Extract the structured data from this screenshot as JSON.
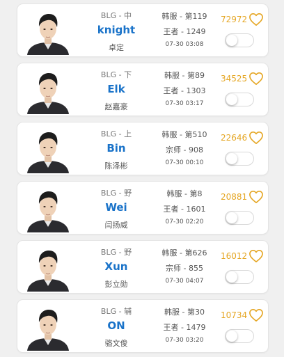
{
  "players": [
    {
      "team": "BLG - 中",
      "nickname": "knight",
      "name": "卓定",
      "server": "韩服 - 第119",
      "tier": "王者 - 1249",
      "time": "07-30 03:08",
      "likes": "72972"
    },
    {
      "team": "BLG - 下",
      "nickname": "Elk",
      "name": "赵嘉豪",
      "server": "韩服 - 第89",
      "tier": "王者 - 1303",
      "time": "07-30 03:17",
      "likes": "34525"
    },
    {
      "team": "BLG - 上",
      "nickname": "Bin",
      "name": "陈泽彬",
      "server": "韩服 - 第510",
      "tier": "宗师 - 908",
      "time": "07-30 00:10",
      "likes": "22646"
    },
    {
      "team": "BLG - 野",
      "nickname": "Wei",
      "name": "闫扬威",
      "server": "韩服 - 第8",
      "tier": "王者 - 1601",
      "time": "07-30 02:20",
      "likes": "20881"
    },
    {
      "team": "BLG - 野",
      "nickname": "Xun",
      "name": "彭立勋",
      "server": "韩服 - 第626",
      "tier": "宗师 - 855",
      "time": "07-30 04:07",
      "likes": "16012"
    },
    {
      "team": "BLG - 辅",
      "nickname": "ON",
      "name": "骆文俊",
      "server": "韩服 - 第30",
      "tier": "王者 - 1479",
      "time": "07-30 03:20",
      "likes": "10734"
    }
  ],
  "icons": {
    "like": "heart-outline-icon",
    "avatar": "player-portrait"
  },
  "colors": {
    "nickname": "#1a73c9",
    "likes": "#e5a623",
    "card": "#ffffff",
    "background": "#f0f0f0"
  }
}
